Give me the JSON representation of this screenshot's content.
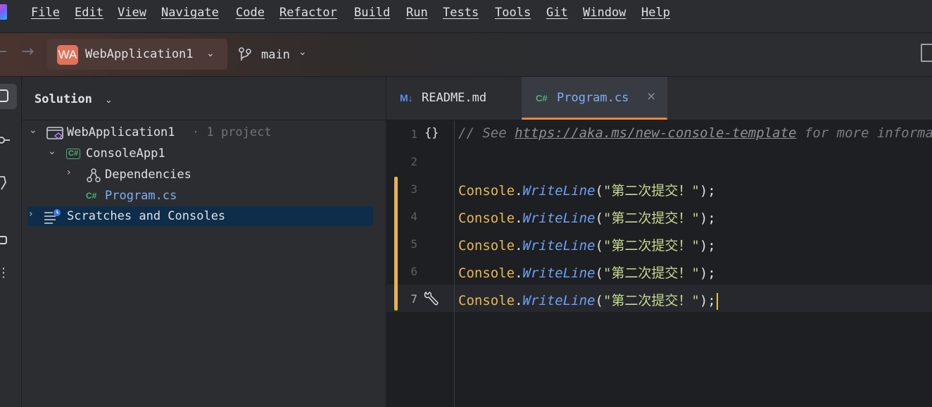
{
  "menu": [
    "File",
    "Edit",
    "View",
    "Navigate",
    "Code",
    "Refactor",
    "Build",
    "Run",
    "Tests",
    "Tools",
    "Git",
    "Window",
    "Help"
  ],
  "toolbar": {
    "project_badge": "WA",
    "project_name": "WebApplication1",
    "branch": "main"
  },
  "solution": {
    "title": "Solution",
    "tree": {
      "root_name": "WebApplication1",
      "root_meta": "· 1 project",
      "project_icon": "C#",
      "project_name": "ConsoleApp1",
      "dependencies": "Dependencies",
      "file_icon": "C#",
      "file_name": "Program.cs",
      "scratches": "Scratches and Consoles"
    }
  },
  "tabs": {
    "readme_icon": "M↓",
    "readme": "README.md",
    "program_icon": "C#",
    "program": "Program.cs"
  },
  "editor": {
    "line_numbers": [
      "1",
      "2",
      "3",
      "4",
      "5",
      "6",
      "7"
    ],
    "comment_prefix": "// See ",
    "comment_url": "https://aka.ms/new-console-template",
    "comment_suffix": " for more information",
    "code_class": "Console",
    "code_method": "WriteLine",
    "code_text": "第二次提交！",
    "lines": [
      {
        "class": "Console",
        "method": "WriteLine",
        "text": "第二次提交！"
      },
      {
        "class": "Console",
        "method": "WriteLine",
        "text": "第二次提交！"
      },
      {
        "class": "Console",
        "method": "WriteLine",
        "text": "第二次提交！"
      },
      {
        "class": "Console",
        "method": "WriteLine",
        "text": "第二次提交！"
      },
      {
        "class": "Console",
        "method": "WriteLine",
        "text": "第二次提交！"
      }
    ]
  }
}
